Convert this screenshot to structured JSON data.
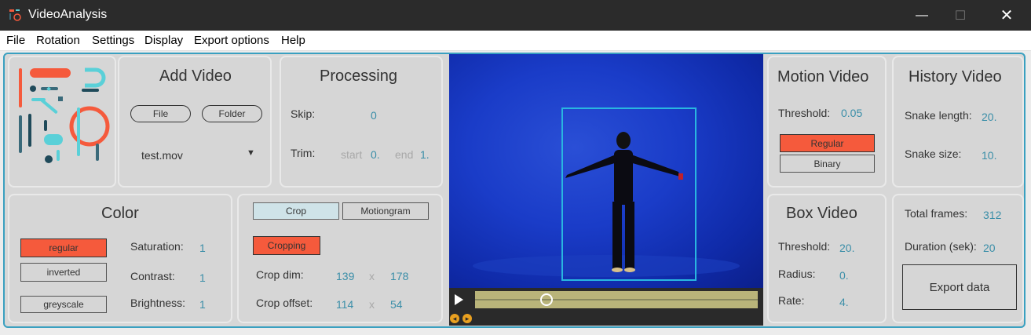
{
  "window": {
    "title": "VideoAnalysis",
    "minimize": "—",
    "maximize": "☐",
    "close": "✕"
  },
  "menu": [
    "File",
    "Rotation",
    "Settings",
    "Display",
    "Export options",
    "Help"
  ],
  "add_video": {
    "title": "Add Video",
    "file_button": "File",
    "folder_button": "Folder",
    "selected_file": "test.mov"
  },
  "processing": {
    "title": "Processing",
    "skip_label": "Skip:",
    "skip_value": "0",
    "trim_label": "Trim:",
    "start_label": "start",
    "start_value": "0.",
    "end_label": "end",
    "end_value": "1."
  },
  "color": {
    "title": "Color",
    "modes": [
      "regular",
      "inverted",
      "greyscale"
    ],
    "active_mode": "regular",
    "saturation_label": "Saturation:",
    "saturation_value": "1",
    "contrast_label": "Contrast:",
    "contrast_value": "1",
    "brightness_label": "Brightness:",
    "brightness_value": "1"
  },
  "crop": {
    "tab_crop": "Crop",
    "tab_motiongram": "Motiongram",
    "cropping_button": "Cropping",
    "crop_dim_label": "Crop dim:",
    "crop_dim_w": "139",
    "crop_dim_x": "x",
    "crop_dim_h": "178",
    "crop_offset_label": "Crop offset:",
    "crop_offset_x": "114",
    "crop_offset_sep": "x",
    "crop_offset_y": "54"
  },
  "player": {
    "position_fraction": 0.24
  },
  "motion_video": {
    "title": "Motion Video",
    "threshold_label": "Threshold:",
    "threshold_value": "0.05",
    "regular_button": "Regular",
    "binary_button": "Binary"
  },
  "history_video": {
    "title": "History Video",
    "snake_length_label": "Snake length:",
    "snake_length_value": "20.",
    "snake_size_label": "Snake size:",
    "snake_size_value": "10."
  },
  "box_video": {
    "title": "Box Video",
    "threshold_label": "Threshold:",
    "threshold_value": "20.",
    "radius_label": "Radius:",
    "radius_value": "0.",
    "rate_label": "Rate:",
    "rate_value": "4."
  },
  "stats": {
    "total_frames_label": "Total frames:",
    "total_frames_value": "312",
    "duration_label": "Duration (sek):",
    "duration_value": "20",
    "export_button": "Export data"
  },
  "colors": {
    "accent": "#3aa0c0",
    "active": "#f55a3c",
    "value_text": "#3a8ea8",
    "video_bg": "#1a3cc8",
    "bbox": "#29b6e0"
  }
}
